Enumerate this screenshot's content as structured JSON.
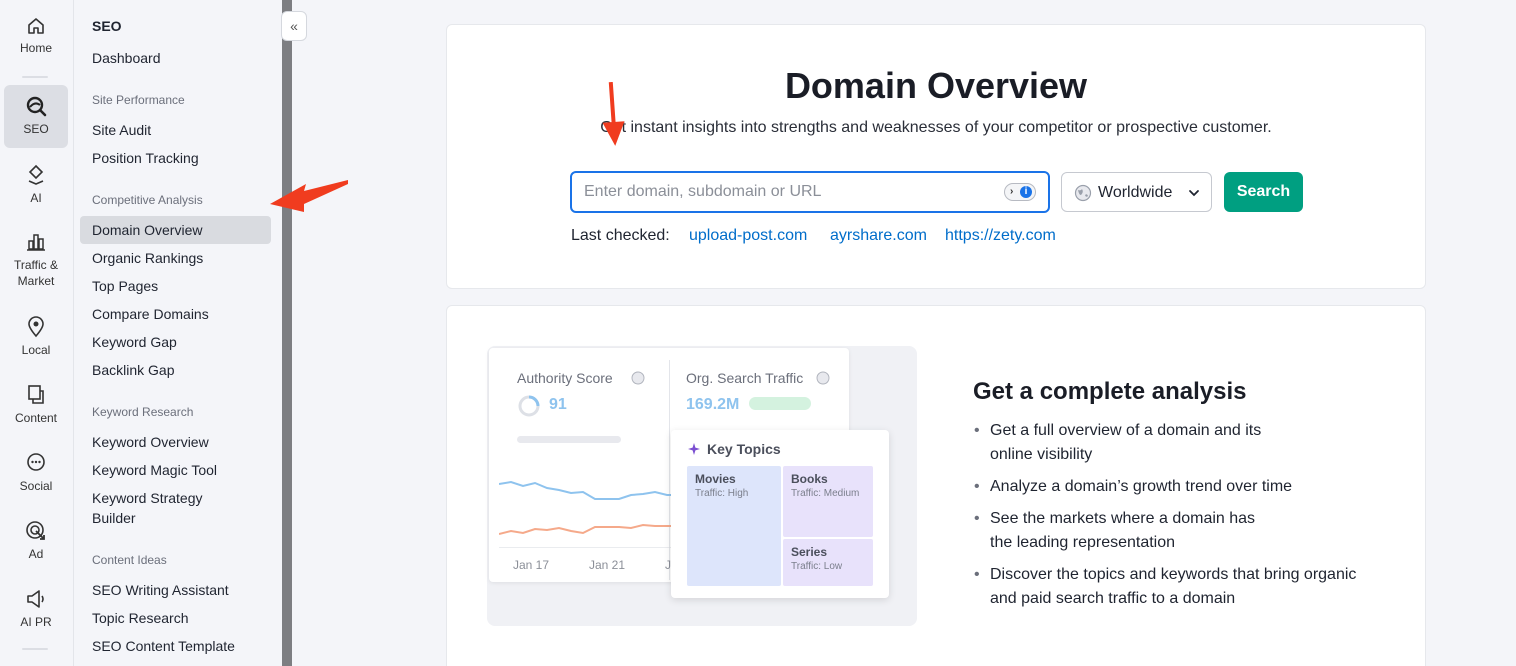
{
  "rail": {
    "items": [
      {
        "label": "Home",
        "icon": "home-icon"
      },
      {
        "label": "SEO",
        "icon": "seo-icon",
        "active": true
      },
      {
        "label": "AI",
        "icon": "ai-icon"
      },
      {
        "label": "Traffic & Market",
        "line1": "Traffic &",
        "line2": "Market",
        "icon": "traffic-market-icon"
      },
      {
        "label": "Local",
        "icon": "location-pin-icon"
      },
      {
        "label": "Content",
        "icon": "content-icon"
      },
      {
        "label": "Social",
        "icon": "social-chat-icon"
      },
      {
        "label": "Ad",
        "icon": "ad-target-icon"
      },
      {
        "label": "AI PR",
        "icon": "megaphone-icon"
      }
    ]
  },
  "sidebar": {
    "title": "SEO",
    "dashboard": "Dashboard",
    "sections": [
      {
        "title": "Site Performance",
        "items": [
          "Site Audit",
          "Position Tracking"
        ]
      },
      {
        "title": "Competitive Analysis",
        "items": [
          "Domain Overview",
          "Organic Rankings",
          "Top Pages",
          "Compare Domains",
          "Keyword Gap",
          "Backlink Gap"
        ]
      },
      {
        "title": "Keyword Research",
        "items": [
          "Keyword Overview",
          "Keyword Magic Tool",
          "Keyword Strategy",
          "Builder"
        ]
      },
      {
        "title": "Content Ideas",
        "items": [
          "SEO Writing Assistant",
          "Topic Research",
          "SEO Content Template"
        ]
      }
    ],
    "active_item": "Domain Overview",
    "collapse_icon": "«"
  },
  "main": {
    "title": "Domain Overview",
    "subtitle": "Get instant insights into strengths and weaknesses of your competitor or prospective customer.",
    "search": {
      "placeholder": "Enter domain, subdomain or URL",
      "value": "",
      "database": "Worldwide",
      "button": "Search"
    },
    "last_checked": {
      "label": "Last checked:",
      "links": [
        "upload-post.com",
        "ayrshare.com",
        "https://zety.com"
      ]
    }
  },
  "promo": {
    "illustration": {
      "authority_label": "Authority Score",
      "authority_value": "91",
      "traffic_label": "Org. Search Traffic",
      "traffic_value": "169.2M",
      "dates": [
        "Jan 17",
        "Jan 21",
        "J"
      ],
      "topics_title": "Key Topics",
      "topics": [
        {
          "name": "Movies",
          "traffic": "Traffic: High"
        },
        {
          "name": "Books",
          "traffic": "Traffic: Medium"
        },
        {
          "name": "Series",
          "traffic": "Traffic: Low"
        }
      ]
    },
    "title": "Get a complete analysis",
    "bullets": [
      {
        "line1": "Get a full overview of a domain and its",
        "line2": "online visibility"
      },
      {
        "line1": "Analyze a domain’s growth trend over time",
        "line2": ""
      },
      {
        "line1": "See the markets where a domain has",
        "line2": "the leading representation"
      },
      {
        "line1": "Discover the topics and keywords that bring organic",
        "line2": "and paid search traffic to a domain"
      }
    ]
  },
  "colors": {
    "accent_blue": "#1a73e8",
    "search_green": "#009f81",
    "link_blue": "#006dca",
    "annotation_arrow": "#f03c1f"
  }
}
